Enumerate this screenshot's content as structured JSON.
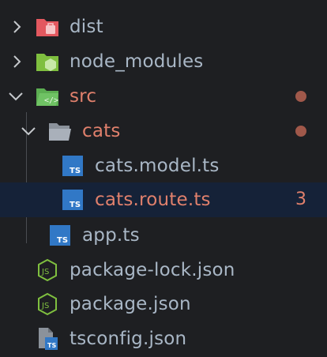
{
  "colors": {
    "background": "#1e1f22",
    "selected_row": "#152238",
    "text_default": "#a9b7c6",
    "text_modified": "#e0806c",
    "modified_dot": "#a0584a",
    "ts_badge_bg": "#3178c6",
    "node_green": "#7fbf3f",
    "dist_red": "#e3585f",
    "src_green": "#5cae52",
    "folder_gray": "#a9b0ba"
  },
  "tree": {
    "items": [
      {
        "label": "dist",
        "icon": "folder-dist-icon",
        "expanded": false
      },
      {
        "label": "node_modules",
        "icon": "folder-node-icon",
        "expanded": false
      },
      {
        "label": "src",
        "icon": "folder-src-icon",
        "expanded": true,
        "modified": true
      },
      {
        "label": "cats",
        "icon": "folder-open-icon",
        "expanded": true,
        "modified": true
      },
      {
        "label": "cats.model.ts",
        "icon": "typescript-file-icon",
        "ts_text": "TS"
      },
      {
        "label": "cats.route.ts",
        "icon": "typescript-file-icon",
        "ts_text": "TS",
        "selected": true,
        "problem_count": "3"
      },
      {
        "label": "app.ts",
        "icon": "typescript-file-icon",
        "ts_text": "TS"
      },
      {
        "label": "package-lock.json",
        "icon": "nodejs-file-icon"
      },
      {
        "label": "package.json",
        "icon": "nodejs-file-icon"
      },
      {
        "label": "tsconfig.json",
        "icon": "tsconfig-file-icon",
        "ts_text": "TS"
      }
    ]
  }
}
